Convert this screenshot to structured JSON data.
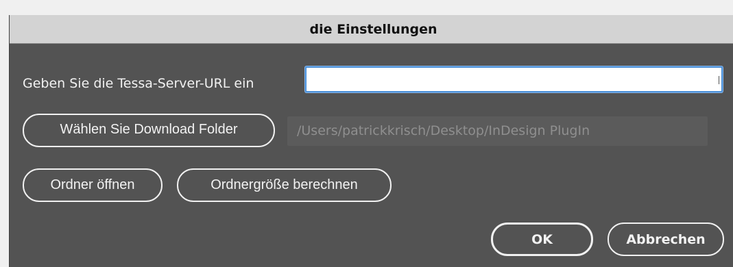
{
  "dialog": {
    "title": "die Einstellungen"
  },
  "server": {
    "label": "Geben Sie die Tessa-Server-URL ein",
    "url_value": "",
    "url_placeholder": ""
  },
  "download": {
    "button_label": "Wählen Sie Download Folder",
    "path_value": "/Users/patrickkrisch/Desktop/InDesign PlugIn"
  },
  "folder_actions": {
    "open_label": "Ordner öffnen",
    "size_label": "Ordnergröße berechnen"
  },
  "footer": {
    "ok_label": "OK",
    "cancel_label": "Abbrechen"
  },
  "colors": {
    "dialog_bg": "#535353",
    "titlebar_bg": "#d3d3d3",
    "focus_accent": "#4a90d9",
    "text_light": "#f1f1f1",
    "path_text": "#8f8f8f"
  }
}
